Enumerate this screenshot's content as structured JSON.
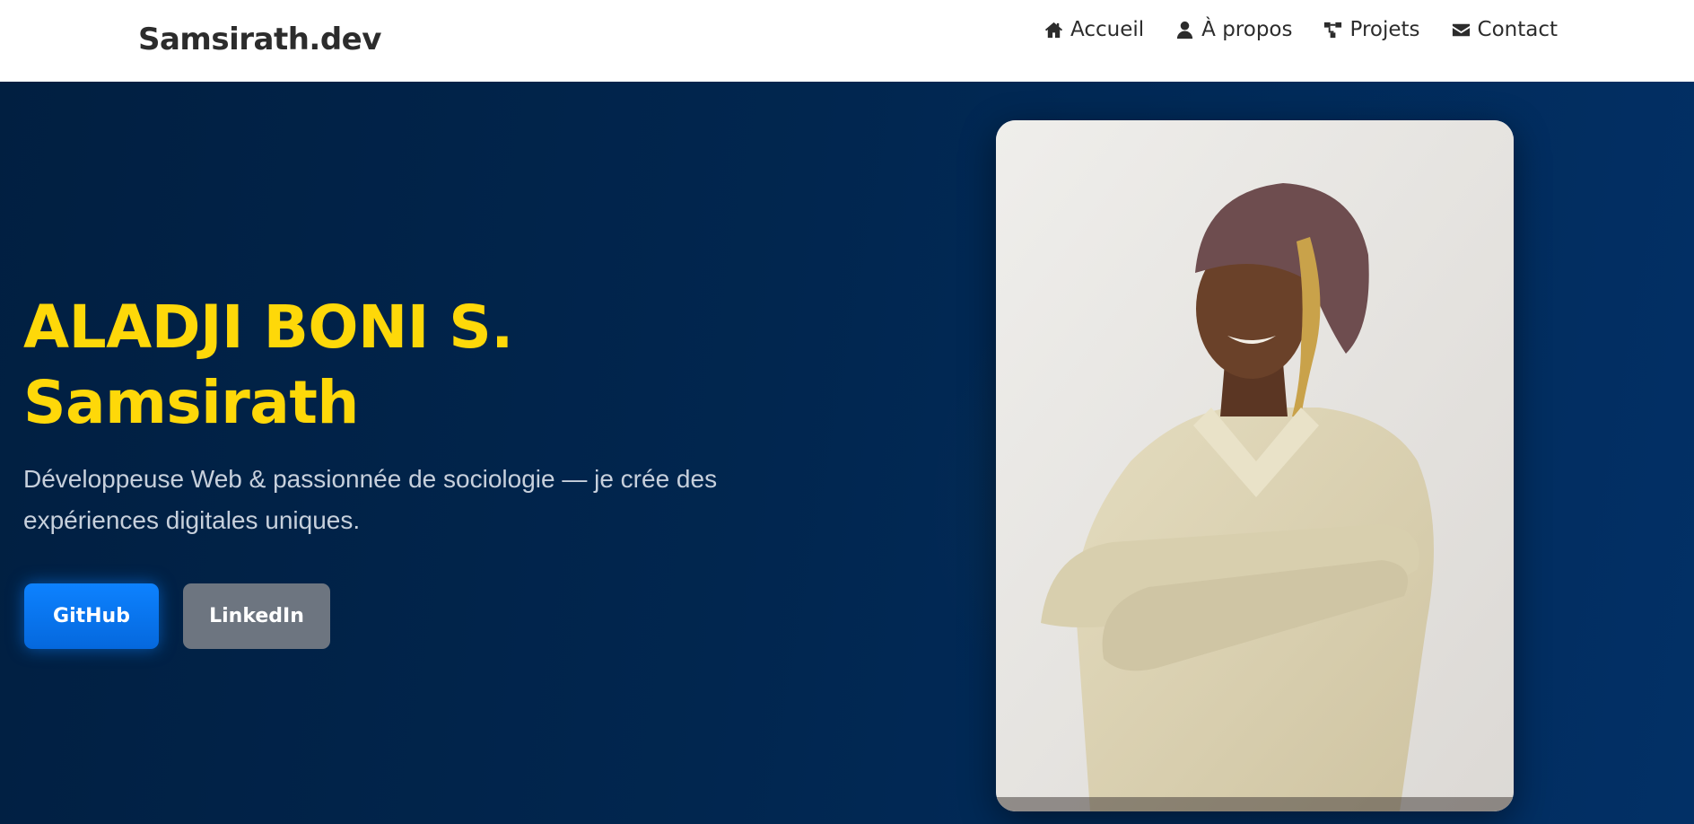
{
  "header": {
    "brand": "Samsirath.dev",
    "nav": [
      {
        "label": "Accueil",
        "icon": "home-icon"
      },
      {
        "label": "À propos",
        "icon": "user-icon"
      },
      {
        "label": "Projets",
        "icon": "sitemap-icon"
      },
      {
        "label": "Contact",
        "icon": "envelope-icon"
      }
    ]
  },
  "hero": {
    "title_line1": "ALADJI BONI S.",
    "title_line2": "Samsirath",
    "subtitle": "Développeuse Web & passionnée de sociologie — je crée des expériences digitales uniques.",
    "buttons": {
      "github": "GitHub",
      "linkedin": "LinkedIn"
    },
    "photo": "profile-photo"
  },
  "colors": {
    "accent": "#fed809",
    "primary_button": "#0d82ff",
    "secondary_button": "#6d7580",
    "background": "#012a56"
  }
}
